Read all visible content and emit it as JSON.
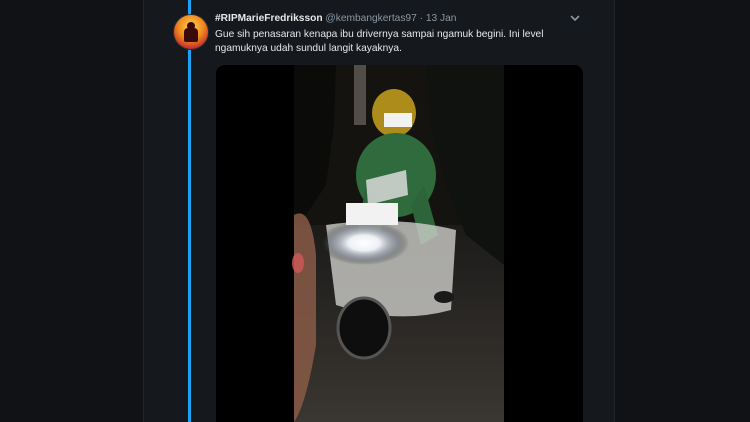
{
  "tweet": {
    "display_name": "#RIPMarieFredriksson",
    "handle": "@kembangkertas97",
    "separator": "·",
    "date": "13 Jan",
    "text": "Gue sih penasaran kenapa ibu drivernya sampai ngamuk begini. Ini level ngamuknya udah sundul langit kayaknya.",
    "more_icon": "chevron-down-icon",
    "avatar_icon": "profile-avatar"
  },
  "media": {
    "type": "video-frame",
    "description": "Dark night video of a person in a green jacket and helmet seated on a white scooter with its headlight on; face and front panel are blurred."
  },
  "colors": {
    "thread_line": "#1da1f2",
    "background": "#15181c",
    "text": "#e6e9ea",
    "muted": "#8899a6"
  }
}
